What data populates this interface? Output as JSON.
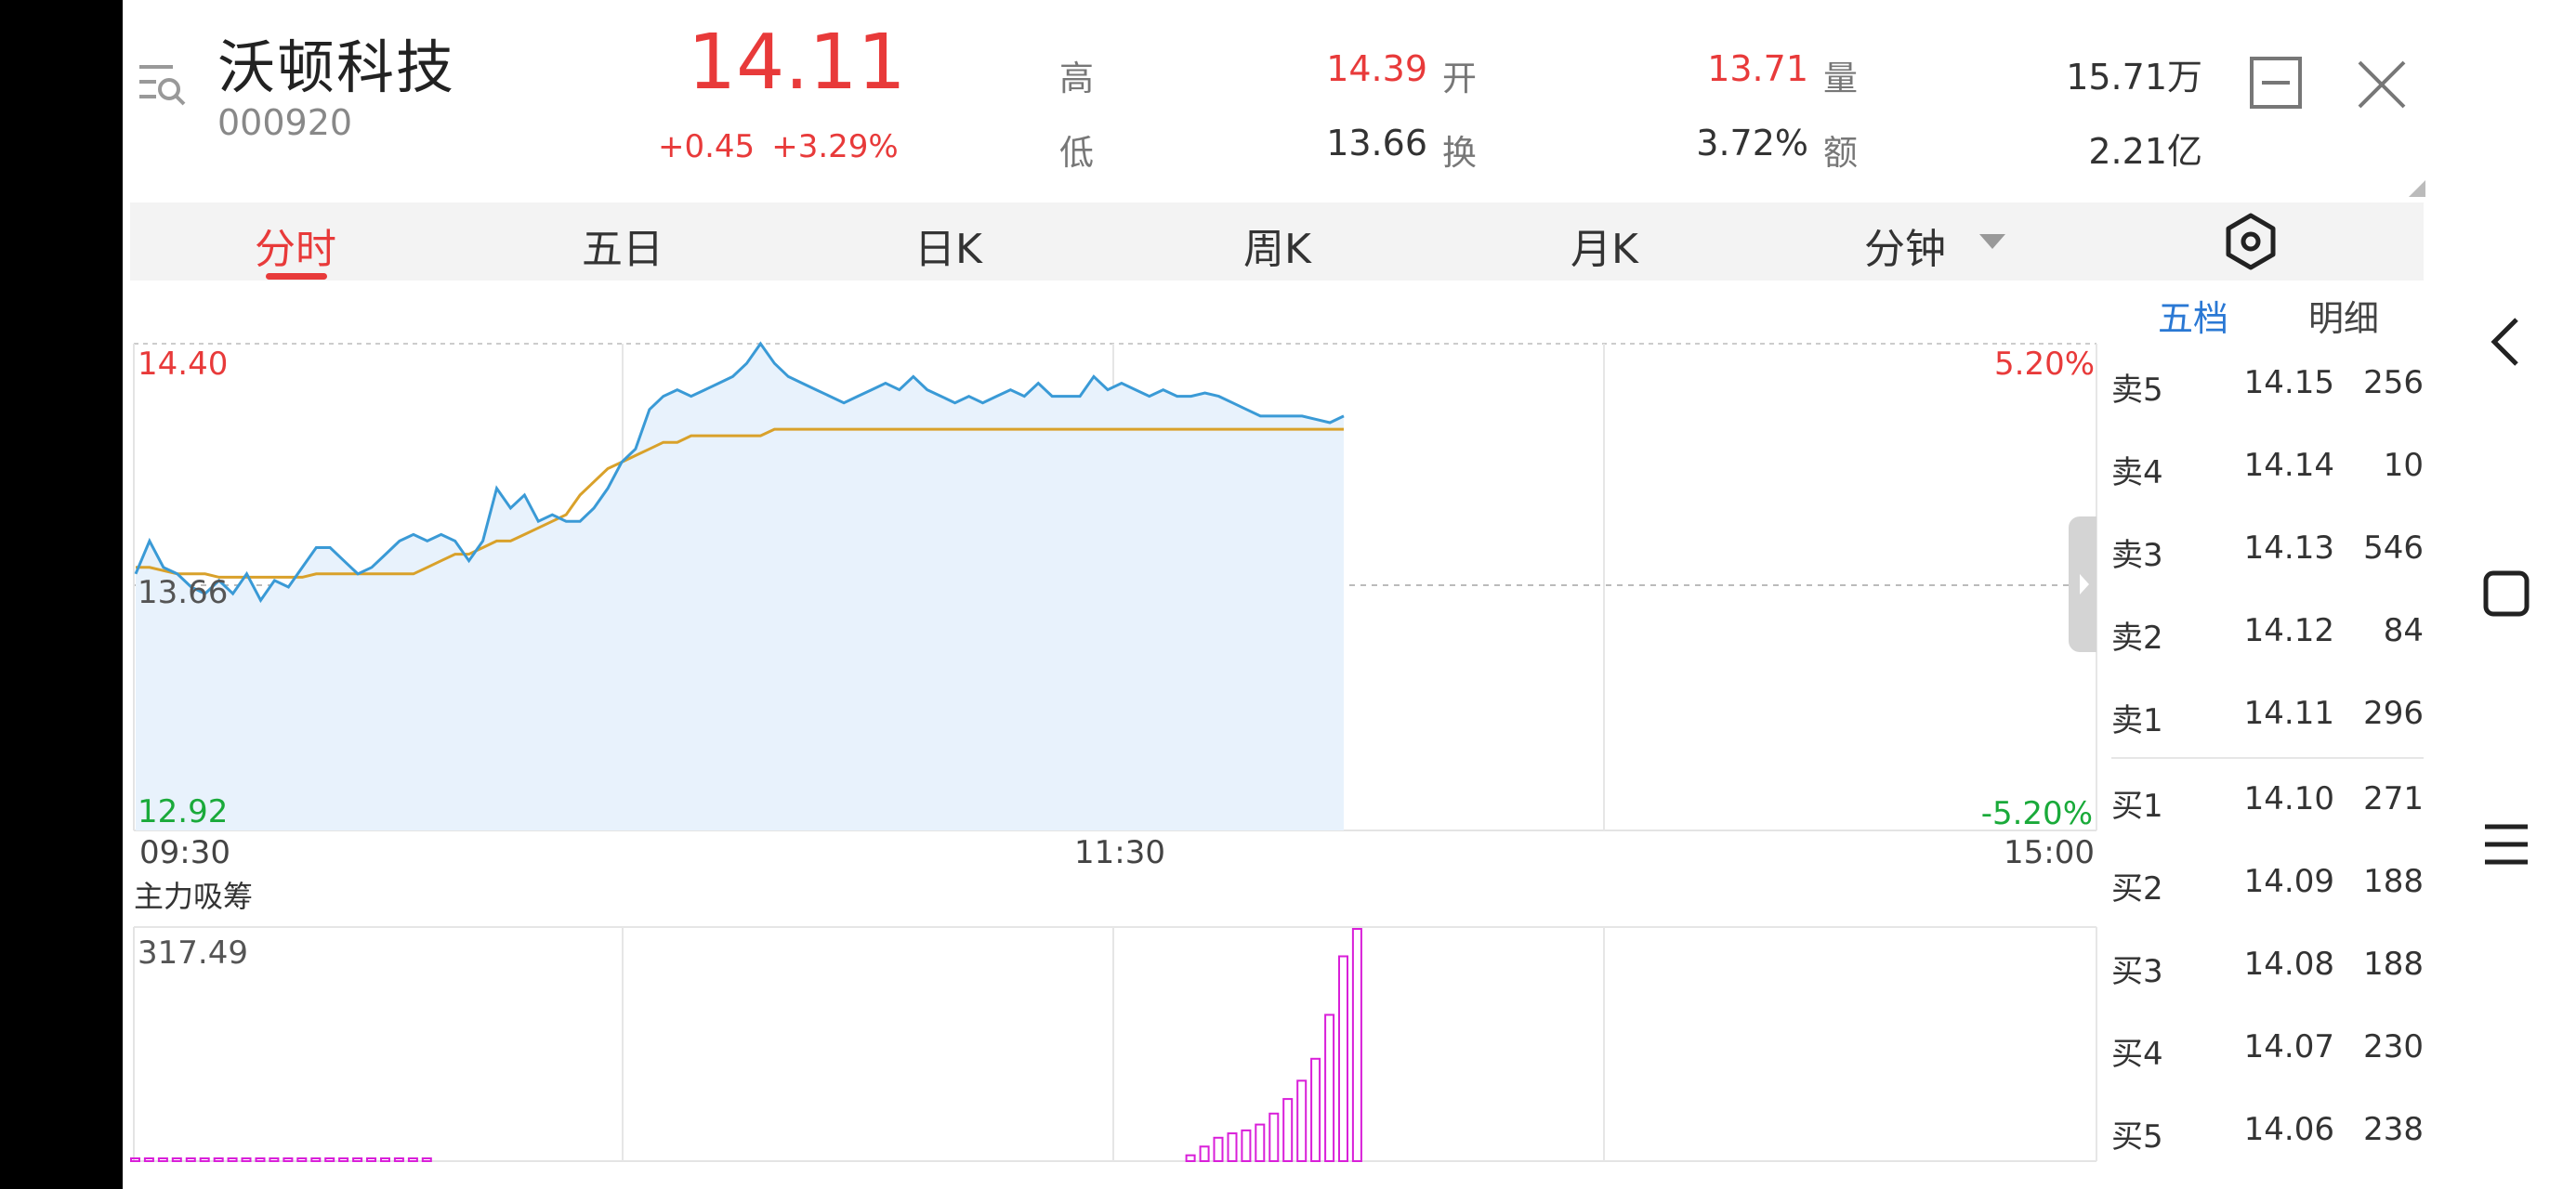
{
  "stock": {
    "name": "沃顿科技",
    "code": "000920",
    "price": "14.11",
    "change": "+0.45",
    "change_pct": "+3.29%"
  },
  "stats": {
    "high_label": "高",
    "high": "14.39",
    "open_label": "开",
    "open": "13.71",
    "vol_label": "量",
    "vol": "15.71万",
    "low_label": "低",
    "low": "13.66",
    "turnover_label": "换",
    "turnover": "3.72%",
    "amount_label": "额",
    "amount": "2.21亿"
  },
  "tabs": [
    "分时",
    "五日",
    "日K",
    "周K",
    "月K",
    "分钟"
  ],
  "active_tab": "分时",
  "chart": {
    "price_max": "14.40",
    "price_mid": "13.66",
    "price_min": "12.92",
    "pct_max": "5.20%",
    "pct_min": "-5.20%",
    "time_start": "09:30",
    "time_mid": "11:30",
    "time_end": "15:00",
    "indicator_title": "主力吸筹",
    "indicator_max": "317.49"
  },
  "chart_data": {
    "type": "line",
    "ylim": [
      12.92,
      14.4
    ],
    "series": [
      {
        "values": [
          13.7,
          13.8,
          13.72,
          13.7,
          13.66,
          13.64,
          13.68,
          13.64,
          13.7,
          13.62,
          13.68,
          13.66,
          13.72,
          13.78,
          13.78,
          13.74,
          13.7,
          13.72,
          13.76,
          13.8,
          13.82,
          13.8,
          13.82,
          13.8,
          13.74,
          13.8,
          13.96,
          13.9,
          13.94,
          13.86,
          13.88,
          13.86,
          13.86,
          13.9,
          13.96,
          14.04,
          14.08,
          14.2,
          14.24,
          14.26,
          14.24,
          14.26,
          14.28,
          14.3,
          14.34,
          14.4,
          14.34,
          14.3,
          14.28,
          14.26,
          14.24,
          14.22,
          14.24,
          14.26,
          14.28,
          14.26,
          14.3,
          14.26,
          14.24,
          14.22,
          14.24,
          14.22,
          14.24,
          14.26,
          14.24,
          14.28,
          14.24,
          14.24,
          14.24,
          14.3,
          14.26,
          14.28,
          14.26,
          14.24,
          14.26,
          14.24,
          14.24,
          14.25,
          14.24,
          14.22,
          14.2,
          14.18,
          14.18,
          14.18,
          14.18,
          14.17,
          14.16,
          14.18
        ]
      },
      {
        "values": [
          13.72,
          13.72,
          13.71,
          13.7,
          13.7,
          13.7,
          13.69,
          13.69,
          13.69,
          13.69,
          13.69,
          13.69,
          13.69,
          13.7,
          13.7,
          13.7,
          13.7,
          13.7,
          13.7,
          13.7,
          13.7,
          13.72,
          13.74,
          13.76,
          13.76,
          13.78,
          13.8,
          13.8,
          13.82,
          13.84,
          13.86,
          13.88,
          13.94,
          13.98,
          14.02,
          14.04,
          14.06,
          14.08,
          14.1,
          14.1,
          14.12,
          14.12,
          14.12,
          14.12,
          14.12,
          14.12,
          14.14,
          14.14,
          14.14,
          14.14,
          14.14,
          14.14,
          14.14,
          14.14,
          14.14,
          14.14,
          14.14,
          14.14,
          14.14,
          14.14,
          14.14,
          14.14,
          14.14,
          14.14,
          14.14,
          14.14,
          14.14,
          14.14,
          14.14,
          14.14,
          14.14,
          14.14,
          14.14,
          14.14,
          14.14,
          14.14,
          14.14,
          14.14,
          14.14,
          14.14,
          14.14,
          14.14,
          14.14,
          14.14,
          14.14,
          14.14,
          14.14,
          14.14
        ]
      },
      {
        "values": [
          1,
          2,
          2,
          1,
          1,
          1,
          1,
          1,
          1,
          1,
          1,
          1,
          1,
          1,
          1,
          1,
          1,
          1,
          1,
          1,
          1,
          1,
          0,
          0,
          0,
          0,
          0,
          0,
          0,
          0,
          0,
          0,
          0,
          0,
          0,
          0,
          0,
          0,
          0,
          0,
          0,
          0,
          0,
          0,
          0,
          0,
          0,
          0,
          0,
          0,
          0,
          0,
          0,
          0,
          0,
          0,
          0,
          0,
          0,
          0,
          0,
          0,
          0,
          0,
          0,
          0,
          0,
          0,
          0,
          0,
          0,
          0,
          0,
          0,
          0,
          0,
          8,
          20,
          32,
          38,
          42,
          50,
          65,
          85,
          110,
          140,
          200,
          280,
          317.49
        ]
      }
    ]
  },
  "orderbook": {
    "tabs": [
      "五档",
      "明细"
    ],
    "sell": [
      {
        "label": "卖5",
        "price": "14.15",
        "vol": "256"
      },
      {
        "label": "卖4",
        "price": "14.14",
        "vol": "10"
      },
      {
        "label": "卖3",
        "price": "14.13",
        "vol": "546"
      },
      {
        "label": "卖2",
        "price": "14.12",
        "vol": "84"
      },
      {
        "label": "卖1",
        "price": "14.11",
        "vol": "296"
      }
    ],
    "buy": [
      {
        "label": "买1",
        "price": "14.10",
        "vol": "271"
      },
      {
        "label": "买2",
        "price": "14.09",
        "vol": "188"
      },
      {
        "label": "买3",
        "price": "14.08",
        "vol": "188"
      },
      {
        "label": "买4",
        "price": "14.07",
        "vol": "230"
      },
      {
        "label": "买5",
        "price": "14.06",
        "vol": "238"
      }
    ]
  },
  "colors": {
    "up": "#e83a3a",
    "down": "#1aaa3a",
    "price_line": "#3a9ad6",
    "avg_line": "#d9a12a",
    "indicator": "#d91fd9",
    "accent_blue": "#2a78d4"
  }
}
